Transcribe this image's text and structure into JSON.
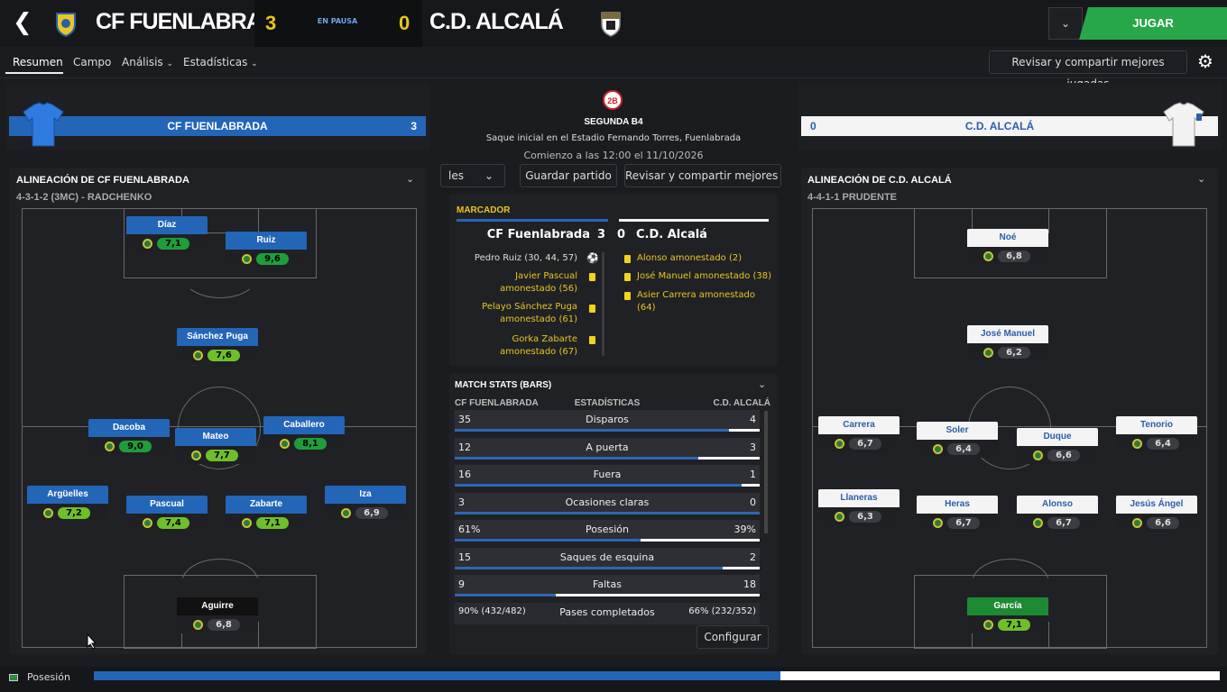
{
  "header": {
    "home_team": "CF FUENLABRADA",
    "home_score": "3",
    "status": "EN PAUSA",
    "away_score": "0",
    "away_team": "C.D. ALCALÁ",
    "play_label": "JUGAR",
    "dropdown_icon": "chevron-down-icon"
  },
  "tabs": [
    {
      "label": "Resumen"
    },
    {
      "label": "Campo"
    },
    {
      "label": "Análisis"
    },
    {
      "label": "Estadísticas"
    }
  ],
  "review_label": "Revisar y compartir mejores jugadas",
  "home": {
    "bar_name": "CF FUENLABRADA",
    "bar_score": "3",
    "lineup_title": "ALINEACIÓN DE CF FUENLABRADA",
    "formation": "4-3-1-2 (3MC) - RADCHENKO",
    "players": [
      {
        "name": "Díaz",
        "rating": "7,1"
      },
      {
        "name": "Ruiz",
        "rating": "9,6"
      },
      {
        "name": "Sánchez Puga",
        "rating": "7,6"
      },
      {
        "name": "Dacoba",
        "rating": "9,0"
      },
      {
        "name": "Mateo",
        "rating": "7,7"
      },
      {
        "name": "Caballero",
        "rating": "8,1"
      },
      {
        "name": "Argüelles",
        "rating": "7,2"
      },
      {
        "name": "Pascual",
        "rating": "7,4"
      },
      {
        "name": "Zabarte",
        "rating": "7,1"
      },
      {
        "name": "Iza",
        "rating": "6,9"
      },
      {
        "name": "Aguirre",
        "rating": "6,8"
      }
    ]
  },
  "away": {
    "bar_name": "C.D. ALCALÁ",
    "bar_score": "0",
    "lineup_title": "ALINEACIÓN DE C.D. ALCALÁ",
    "formation": "4-4-1-1 PRUDENTE",
    "players": [
      {
        "name": "Noé",
        "rating": "6,8"
      },
      {
        "name": "José Manuel",
        "rating": "6,2"
      },
      {
        "name": "Carrera",
        "rating": "6,7"
      },
      {
        "name": "Soler",
        "rating": "6,4"
      },
      {
        "name": "Duque",
        "rating": "6,6"
      },
      {
        "name": "Tenorio",
        "rating": "6,4"
      },
      {
        "name": "Llaneras",
        "rating": "6,3"
      },
      {
        "name": "Heras",
        "rating": "6,7"
      },
      {
        "name": "Alonso",
        "rating": "6,7"
      },
      {
        "name": "Jesús Ángel",
        "rating": "6,6"
      },
      {
        "name": "García",
        "rating": "7,1"
      }
    ]
  },
  "match": {
    "competition": "SEGUNDA B4",
    "badge": "2B",
    "venue": "Saque inicial en el Estadio Fernando Torres, Fuenlabrada",
    "kickoff": "Comienzo a las 12:00 el 11/10/2026",
    "partial_btn": "les",
    "save_btn": "Guardar partido",
    "review_btn": "Revisar y compartir mejores ju"
  },
  "scoreboard": {
    "title": "MARCADOR",
    "home": "CF Fuenlabrada",
    "home_goals": "3",
    "away_goals": "0",
    "away": "C.D. Alcalá",
    "home_events": [
      "Pedro Ruiz (30, 44, 57)",
      "Javier Pascual amonestado (56)",
      "Pelayo Sánchez Puga amonestado (61)",
      "Gorka Zabarte amonestado (67)"
    ],
    "away_events": [
      "Alonso amonestado (2)",
      "José Manuel amonestado (38)",
      "Asier Carrera amonestado (64)"
    ]
  },
  "stats": {
    "title": "MATCH STATS (BARS)",
    "home": "CF FUENLABRADA",
    "mid": "ESTADÍSTICAS",
    "away": "C.D. ALCALÁ",
    "rows": [
      {
        "label": "Disparos",
        "home": "35",
        "away": "4",
        "share": 0.9
      },
      {
        "label": "A puerta",
        "home": "12",
        "away": "3",
        "share": 0.8
      },
      {
        "label": "Fuera",
        "home": "16",
        "away": "1",
        "share": 0.94
      },
      {
        "label": "Ocasiones claras",
        "home": "3",
        "away": "0",
        "share": 1.0
      },
      {
        "label": "Posesión",
        "home": "61%",
        "away": "39%",
        "share": 0.61
      },
      {
        "label": "Saques de esquina",
        "home": "15",
        "away": "2",
        "share": 0.88
      },
      {
        "label": "Faltas",
        "home": "9",
        "away": "18",
        "share": 0.33
      }
    ],
    "passes": {
      "label": "Pases completados",
      "home": "90% (432/482)",
      "away": "66% (232/352)"
    },
    "config_btn": "Configurar"
  },
  "bottom": {
    "label": "Posesión",
    "home_share": 0.61
  },
  "colors": {
    "home": "#2365b7",
    "away": "#f4f4f4",
    "accent": "#e8c521",
    "play": "#27a64a"
  }
}
